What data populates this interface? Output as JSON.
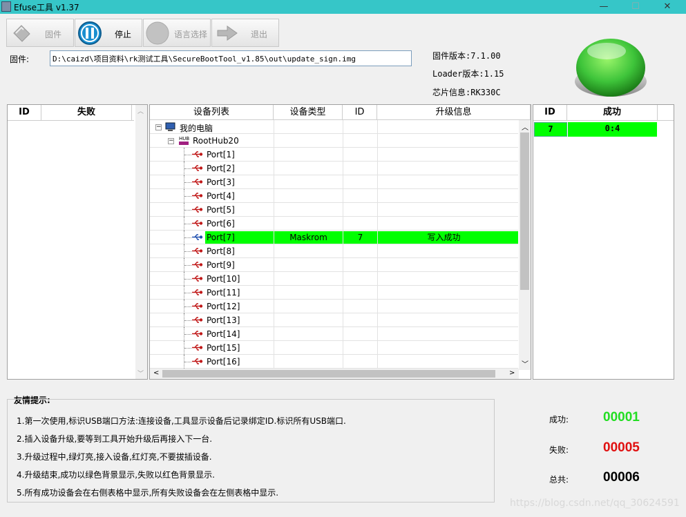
{
  "window": {
    "title": "Efuse工具 v1.37",
    "minimize": "—",
    "maximize": "☐",
    "close": "✕"
  },
  "toolbar": {
    "firmware_label": "固件",
    "stop_label": "停止",
    "language_label": "语言选择",
    "exit_label": "退出"
  },
  "firmware": {
    "label": "固件:",
    "path": "D:\\caizd\\项目资料\\rk测试工具\\SecureBootTool_v1.85\\out\\update_sign.img"
  },
  "info": {
    "firmware_version": "固件版本:7.1.00",
    "loader_version": "Loader版本:1.15",
    "chip_info": "芯片信息:RK330C"
  },
  "status_light_color": "#3ec43a",
  "fail_table": {
    "col_id": "ID",
    "col_status": "失败"
  },
  "device_table": {
    "headers": [
      "设备列表",
      "设备类型",
      "ID",
      "升级信息"
    ],
    "root": "我的电脑",
    "hub": "RootHub20",
    "rows": [
      {
        "name": "Port[1]",
        "type": "",
        "id": "",
        "info": "",
        "active": false
      },
      {
        "name": "Port[2]",
        "type": "",
        "id": "",
        "info": "",
        "active": false
      },
      {
        "name": "Port[3]",
        "type": "",
        "id": "",
        "info": "",
        "active": false
      },
      {
        "name": "Port[4]",
        "type": "",
        "id": "",
        "info": "",
        "active": false
      },
      {
        "name": "Port[5]",
        "type": "",
        "id": "",
        "info": "",
        "active": false
      },
      {
        "name": "Port[6]",
        "type": "",
        "id": "",
        "info": "",
        "active": false
      },
      {
        "name": "Port[7]",
        "type": "Maskrom",
        "id": "7",
        "info": "写入成功",
        "active": true
      },
      {
        "name": "Port[8]",
        "type": "",
        "id": "",
        "info": "",
        "active": false
      },
      {
        "name": "Port[9]",
        "type": "",
        "id": "",
        "info": "",
        "active": false
      },
      {
        "name": "Port[10]",
        "type": "",
        "id": "",
        "info": "",
        "active": false
      },
      {
        "name": "Port[11]",
        "type": "",
        "id": "",
        "info": "",
        "active": false
      },
      {
        "name": "Port[12]",
        "type": "",
        "id": "",
        "info": "",
        "active": false
      },
      {
        "name": "Port[13]",
        "type": "",
        "id": "",
        "info": "",
        "active": false
      },
      {
        "name": "Port[14]",
        "type": "",
        "id": "",
        "info": "",
        "active": false
      },
      {
        "name": "Port[15]",
        "type": "",
        "id": "",
        "info": "",
        "active": false
      },
      {
        "name": "Port[16]",
        "type": "",
        "id": "",
        "info": "",
        "active": false
      }
    ],
    "highlight_color": "#00ff00"
  },
  "success_table": {
    "col_id": "ID",
    "col_status": "成功",
    "rows": [
      {
        "id": "7",
        "value": "0:4"
      }
    ]
  },
  "hints": {
    "title": "友情提示:",
    "lines": [
      "1.第一次使用,标识USB端口方法:连接设备,工具显示设备后记录绑定ID.标识所有USB端口.",
      "2.插入设备升级,要等到工具开始升级后再接入下一台.",
      "3.升级过程中,绿灯亮,接入设备,红灯亮,不要拔插设备.",
      "4.升级结束,成功以绿色背景显示,失败以红色背景显示.",
      "5.所有成功设备会在右侧表格中显示,所有失败设备会在左侧表格中显示."
    ]
  },
  "stats": {
    "success_label": "成功:",
    "success_value": "00001",
    "success_color": "#22dd22",
    "fail_label": "失败:",
    "fail_value": "00005",
    "fail_color": "#e01010",
    "total_label": "总共:",
    "total_value": "00006"
  },
  "watermark": "https://blog.csdn.net/qq_30624591"
}
